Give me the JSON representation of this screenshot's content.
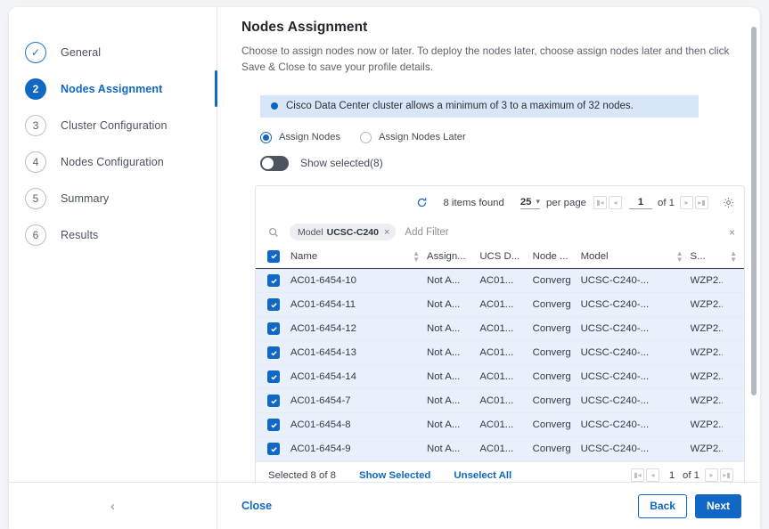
{
  "stepper": {
    "steps": [
      {
        "num": "✓",
        "label": "General",
        "state": "done"
      },
      {
        "num": "2",
        "label": "Nodes Assignment",
        "state": "active"
      },
      {
        "num": "3",
        "label": "Cluster Configuration",
        "state": "idle"
      },
      {
        "num": "4",
        "label": "Nodes Configuration",
        "state": "idle"
      },
      {
        "num": "5",
        "label": "Summary",
        "state": "idle"
      },
      {
        "num": "6",
        "label": "Results",
        "state": "idle"
      }
    ]
  },
  "page": {
    "title": "Nodes Assignment",
    "description": "Choose to assign nodes now or later. To deploy the nodes later, choose assign nodes later and then click Save & Close to save your profile details.",
    "banner": "Cisco Data Center cluster allows a minimum of 3 to a maximum of 32 nodes."
  },
  "assign": {
    "option_now": "Assign Nodes",
    "option_later": "Assign Nodes Later",
    "selected": "Assign Nodes",
    "toggle_label": "Show selected(8)",
    "toggle_on": false
  },
  "toolbar": {
    "refresh_icon": "refresh-icon",
    "items_found": "8 items found",
    "page_size": "25",
    "per_page": "per page",
    "page_current": "1",
    "page_of": "of 1",
    "settings_icon": "gear-icon"
  },
  "filter": {
    "search_icon": "search-icon",
    "chip_key": "Model",
    "chip_value": "UCSC-C240",
    "chip_remove": "×",
    "add_filter": "Add Filter",
    "clear_all": "×"
  },
  "table": {
    "columns": [
      {
        "label": "Name",
        "sortable": true
      },
      {
        "label": "Assign...",
        "sortable": false
      },
      {
        "label": "UCS D...",
        "sortable": false
      },
      {
        "label": "Node ...",
        "sortable": false
      },
      {
        "label": "Model",
        "sortable": true
      },
      {
        "label": "S...",
        "sortable": true
      }
    ],
    "header_checkbox_checked": true,
    "rows": [
      {
        "checked": true,
        "name": "AC01-6454-10",
        "assign": "Not A...",
        "ucs": "AC01...",
        "node": "Converg",
        "model": "UCSC-C240-...",
        "serial": "WZP2..."
      },
      {
        "checked": true,
        "name": "AC01-6454-11",
        "assign": "Not A...",
        "ucs": "AC01...",
        "node": "Converg",
        "model": "UCSC-C240-...",
        "serial": "WZP2..."
      },
      {
        "checked": true,
        "name": "AC01-6454-12",
        "assign": "Not A...",
        "ucs": "AC01...",
        "node": "Converg",
        "model": "UCSC-C240-...",
        "serial": "WZP2..."
      },
      {
        "checked": true,
        "name": "AC01-6454-13",
        "assign": "Not A...",
        "ucs": "AC01...",
        "node": "Converg",
        "model": "UCSC-C240-...",
        "serial": "WZP2..."
      },
      {
        "checked": true,
        "name": "AC01-6454-14",
        "assign": "Not A...",
        "ucs": "AC01...",
        "node": "Converg",
        "model": "UCSC-C240-...",
        "serial": "WZP2..."
      },
      {
        "checked": true,
        "name": "AC01-6454-7",
        "assign": "Not A...",
        "ucs": "AC01...",
        "node": "Converg",
        "model": "UCSC-C240-...",
        "serial": "WZP2..."
      },
      {
        "checked": true,
        "name": "AC01-6454-8",
        "assign": "Not A...",
        "ucs": "AC01...",
        "node": "Converg",
        "model": "UCSC-C240-...",
        "serial": "WZP2..."
      },
      {
        "checked": true,
        "name": "AC01-6454-9",
        "assign": "Not A...",
        "ucs": "AC01...",
        "node": "Converg",
        "model": "UCSC-C240-...",
        "serial": "WZP2..."
      }
    ]
  },
  "table_footer": {
    "selected_text": "Selected 8 of 8",
    "show_selected": "Show Selected",
    "unselect_all": "Unselect All",
    "page_current": "1",
    "page_of": "of 1"
  },
  "footer": {
    "collapse_icon": "chevron-left-icon",
    "close": "Close",
    "back": "Back",
    "next": "Next"
  },
  "colors": {
    "accent": "#1068c4",
    "banner_bg": "#d8e7f7",
    "row_selected_bg": "#e8f1fb"
  }
}
